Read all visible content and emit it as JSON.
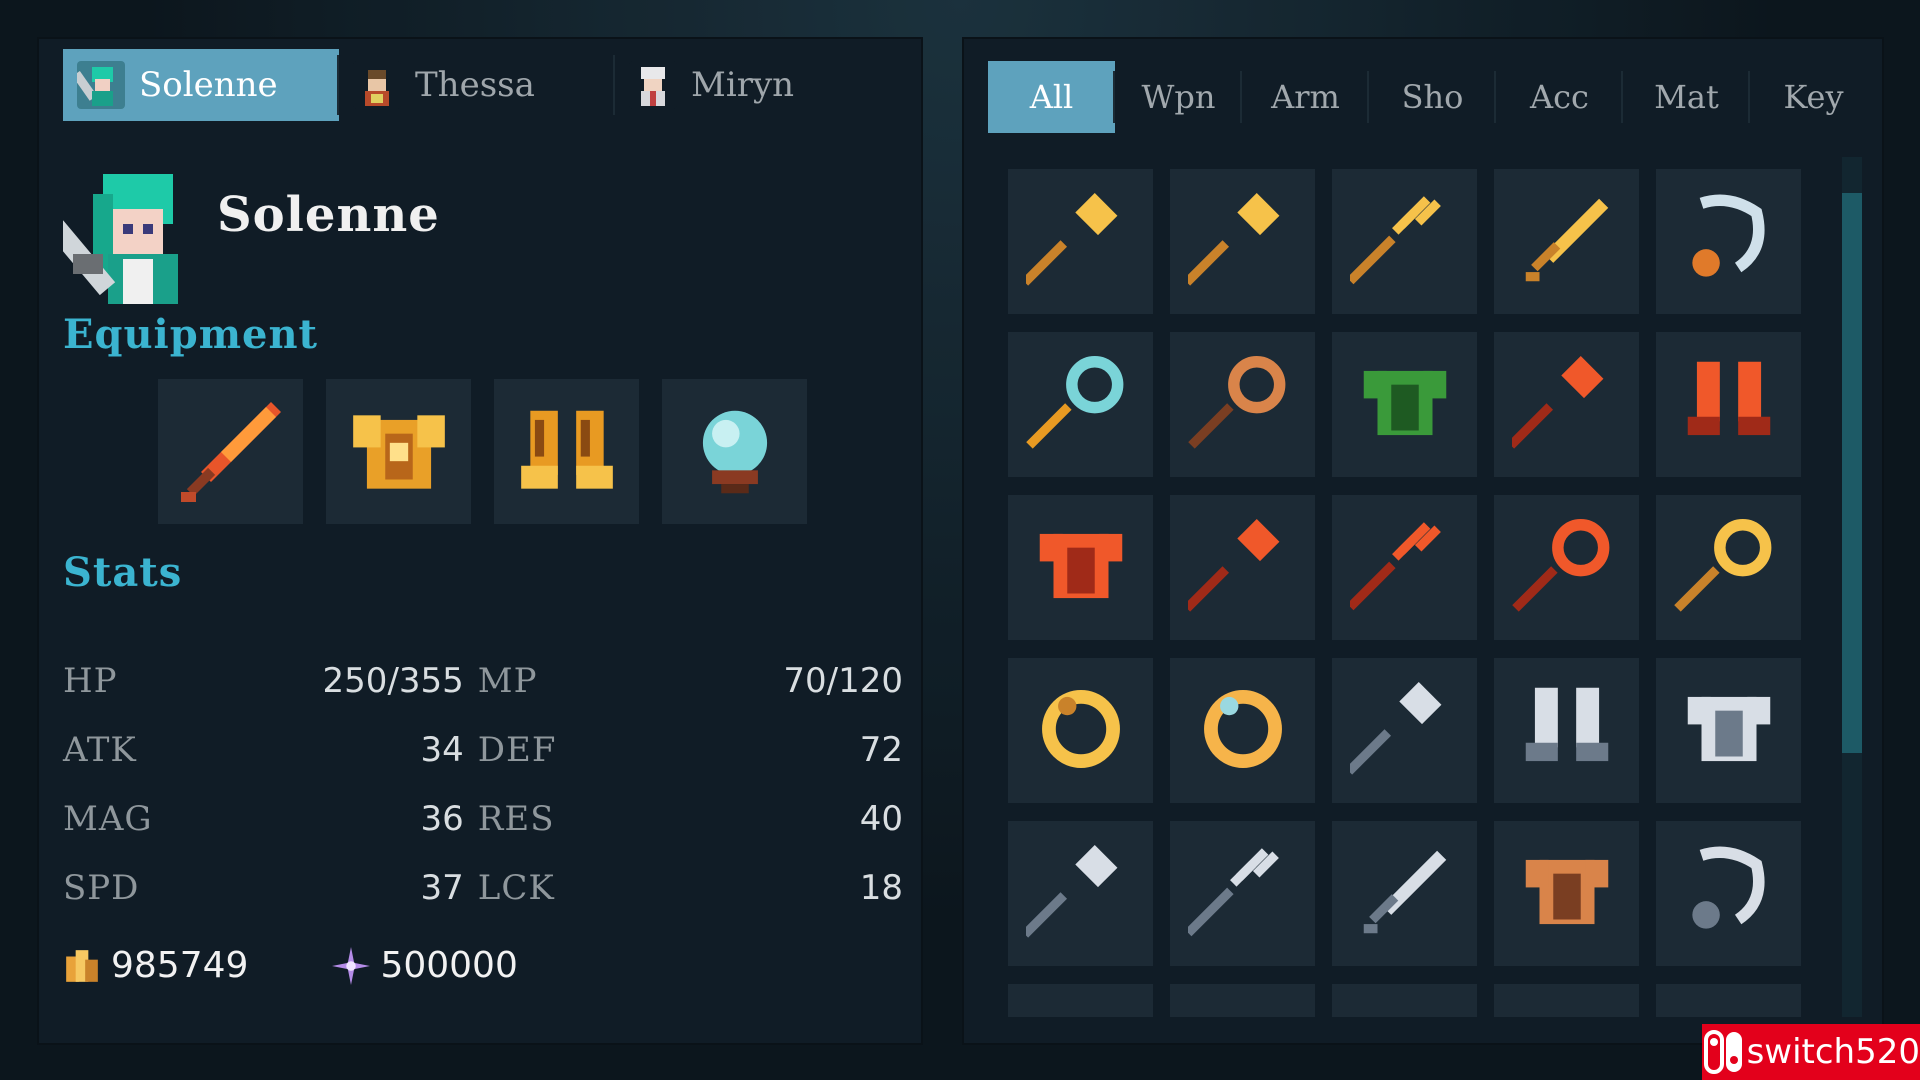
{
  "characters": [
    {
      "name": "Solenne",
      "active": true
    },
    {
      "name": "Thessa",
      "active": false
    },
    {
      "name": "Miryn",
      "active": false
    }
  ],
  "character": {
    "name": "Solenne",
    "equipment_title": "Equipment",
    "equipment": [
      "flame-sword-icon",
      "gold-armor-icon",
      "gold-boots-icon",
      "crystal-orb-icon"
    ],
    "stats_title": "Stats",
    "stats": [
      {
        "name": "HP",
        "value": "250/355",
        "name2": "MP",
        "value2": "70/120"
      },
      {
        "name": "ATK",
        "value": "34",
        "name2": "DEF",
        "value2": "72"
      },
      {
        "name": "MAG",
        "value": "36",
        "name2": "RES",
        "value2": "40"
      },
      {
        "name": "SPD",
        "value": "37",
        "name2": "LCK",
        "value2": "18"
      }
    ],
    "gold": "985749",
    "crystals": "500000"
  },
  "categories": [
    {
      "label": "All",
      "active": true
    },
    {
      "label": "Wpn",
      "active": false
    },
    {
      "label": "Arm",
      "active": false
    },
    {
      "label": "Sho",
      "active": false
    },
    {
      "label": "Acc",
      "active": false
    },
    {
      "label": "Mat",
      "active": false
    },
    {
      "label": "Key",
      "active": false
    }
  ],
  "inventory": [
    "gold-axe-icon",
    "gold-hammer-icon",
    "gold-trident-icon",
    "gold-sword-icon",
    "silver-necklace-icon",
    "teal-whip-icon",
    "bronze-scythe-icon",
    "green-cloak-icon",
    "red-axe-icon",
    "red-gloves-icon",
    "red-armor-icon",
    "red-hammer-icon",
    "red-trident-icon",
    "red-whip-icon",
    "gold-staff-icon",
    "gold-ring-icon",
    "jewel-ring-icon",
    "steel-axe-icon",
    "steel-boots-icon",
    "steel-armor-icon",
    "steel-hammer-icon",
    "steel-trident-icon",
    "steel-sword-icon",
    "bronze-cape-icon",
    "steel-pendant-icon",
    "bronze-item-icon",
    "bronze-item-icon",
    "bronze-item-icon",
    "bronze-item-icon",
    "bronze-item-icon"
  ],
  "colors": {
    "accent": "#5ea2bd",
    "section": "#3bb4d0",
    "panel": "#101c26",
    "slot": "#1c2a35"
  },
  "watermark": "switch520"
}
